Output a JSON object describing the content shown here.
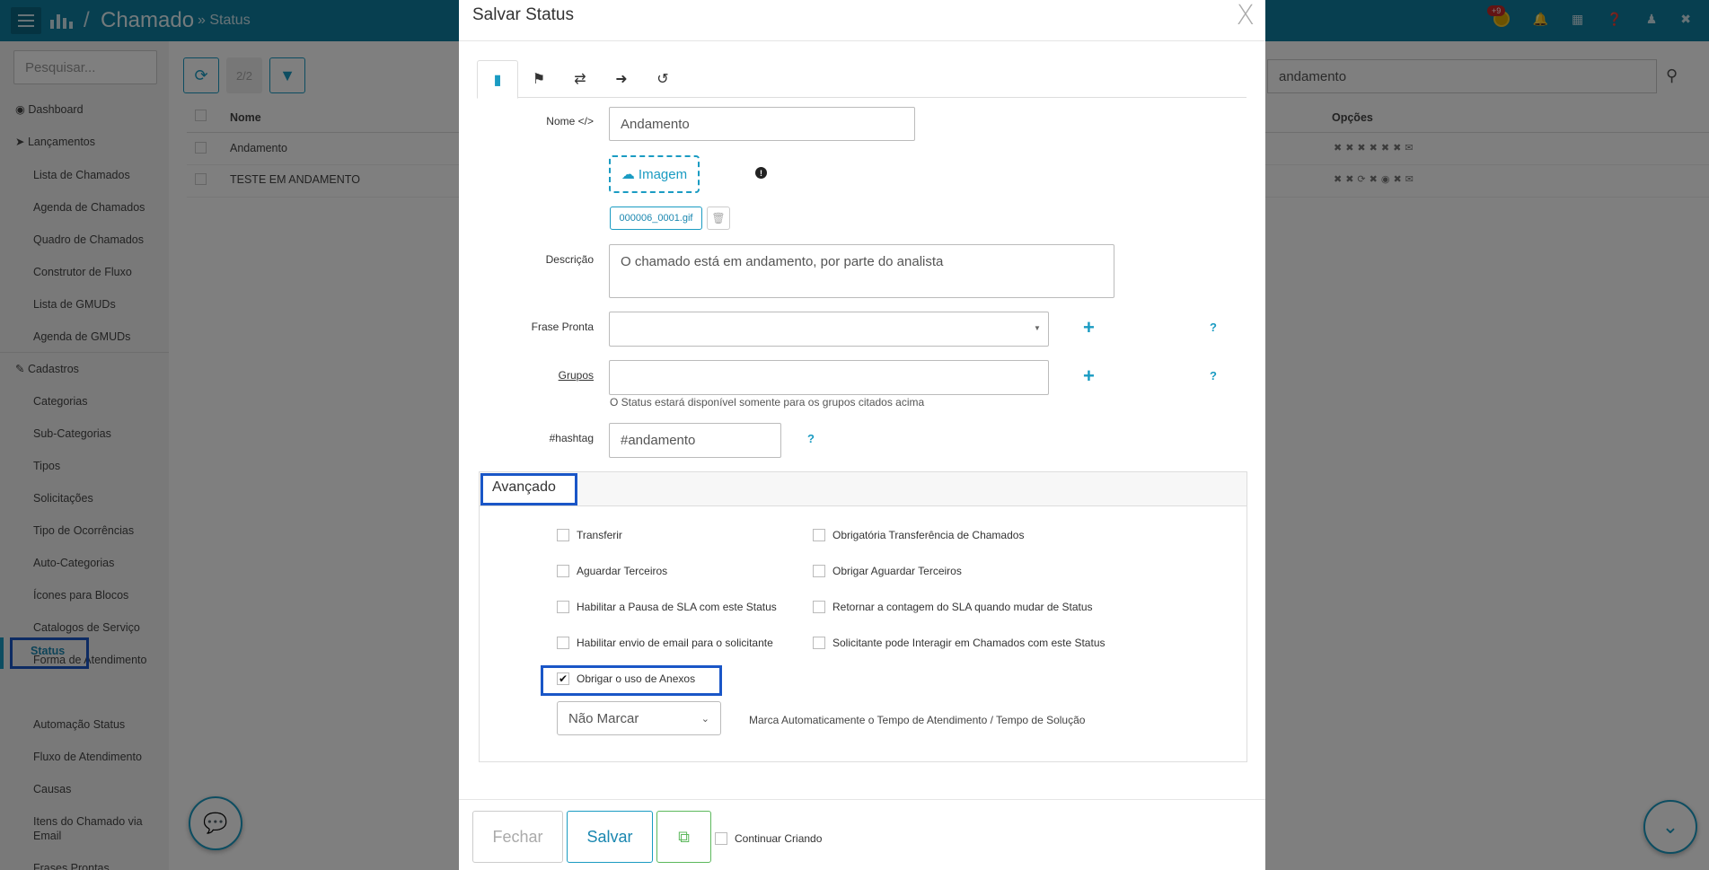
{
  "app": {
    "breadcrumb_title": "Chamado",
    "breadcrumb_sub": "» Status",
    "notification_badge": "+9"
  },
  "sidebar": {
    "search_placeholder": "Pesquisar...",
    "top_items": [
      "Dashboard",
      "Lançamentos"
    ],
    "lancamentos": [
      "Lista de Chamados",
      "Agenda de Chamados",
      "Quadro de Chamados",
      "Construtor de Fluxo",
      "Lista de GMUDs",
      "Agenda de GMUDs"
    ],
    "cadastros_label": "Cadastros",
    "cadastros": [
      "Categorias",
      "Sub-Categorias",
      "Tipos",
      "Solicitações",
      "Tipo de Ocorrências",
      "Auto-Categorias",
      "Ícones para Blocos",
      "Catalogos de Serviço",
      "Forma de Atendimento",
      "Status",
      "Automação Status",
      "Fluxo de Atendimento",
      "Causas",
      "Itens do Chamado via Email",
      "Frases Prontas"
    ]
  },
  "list": {
    "count": "2/2",
    "search_value": "andamento",
    "col_name": "Nome",
    "col_options": "Opções",
    "rows": [
      "Andamento",
      "TESTE EM ANDAMENTO"
    ]
  },
  "modal": {
    "title": "Salvar Status",
    "close": "X",
    "form": {
      "nome_label": "Nome",
      "nome_value": "Andamento",
      "upload_label": "Imagem",
      "file_name": "000006_0001.gif",
      "descricao_label": "Descrição",
      "descricao_value": "O chamado está em andamento, por parte do analista",
      "frase_label": "Frase Pronta",
      "frase_value": "",
      "grupos_label": "Grupos",
      "grupos_value": "",
      "grupos_hint": "O Status estará disponível somente para os grupos citados acima",
      "hashtag_label": "#hashtag",
      "hashtag_value": "#andamento"
    },
    "advanced": {
      "title": "Avançado",
      "options": [
        {
          "label": "Transferir",
          "checked": false
        },
        {
          "label": "Obrigatória Transferência de Chamados",
          "checked": false
        },
        {
          "label": "Aguardar Terceiros",
          "checked": false
        },
        {
          "label": "Obrigar Aguardar Terceiros",
          "checked": false
        },
        {
          "label": "Habilitar a Pausa de SLA com este Status",
          "checked": false
        },
        {
          "label": "Retornar a contagem do SLA quando mudar de Status",
          "checked": false
        },
        {
          "label": "Habilitar envio de email para o solicitante",
          "checked": false
        },
        {
          "label": "Solicitante pode Interagir em Chamados com este Status",
          "checked": false
        },
        {
          "label": "Obrigar o uso de Anexos",
          "checked": true
        }
      ],
      "marcar_select": "Não Marcar",
      "marcar_note": "Marca Automaticamente o Tempo de Atendimento / Tempo de Solução"
    },
    "footer": {
      "close_label": "Fechar",
      "save_label": "Salvar",
      "continue_label": "Continuar Criando"
    }
  },
  "colors": {
    "topbar": "#0f7fa0",
    "accent": "#1a9bc2",
    "highlight": "#1a56c7",
    "copy_green": "#5cb85c"
  }
}
